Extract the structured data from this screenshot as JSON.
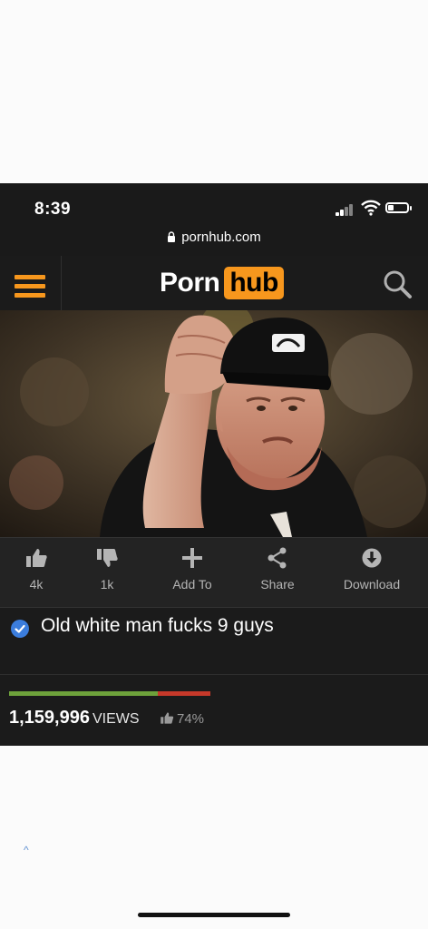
{
  "status_bar": {
    "time": "8:39"
  },
  "browser": {
    "url": "pornhub.com"
  },
  "site": {
    "logo_left": "Porn",
    "logo_right": "hub",
    "accent_color": "#f7971d"
  },
  "video": {
    "thumbnail": "umpire-fist-pump-photo"
  },
  "actions": [
    {
      "icon": "thumbs-up-icon",
      "label": "4k"
    },
    {
      "icon": "thumbs-down-icon",
      "label": "1k"
    },
    {
      "icon": "plus-icon",
      "label": "Add To"
    },
    {
      "icon": "share-icon",
      "label": "Share"
    },
    {
      "icon": "download-icon",
      "label": "Download"
    }
  ],
  "video_info": {
    "title": "Old white man fucks 9 guys",
    "views_count": "1,159,996",
    "views_label": "VIEWS",
    "rating_percent": "74%",
    "rating_fraction": 0.74,
    "good_color": "#6ea23b",
    "bad_color": "#c6392a"
  }
}
